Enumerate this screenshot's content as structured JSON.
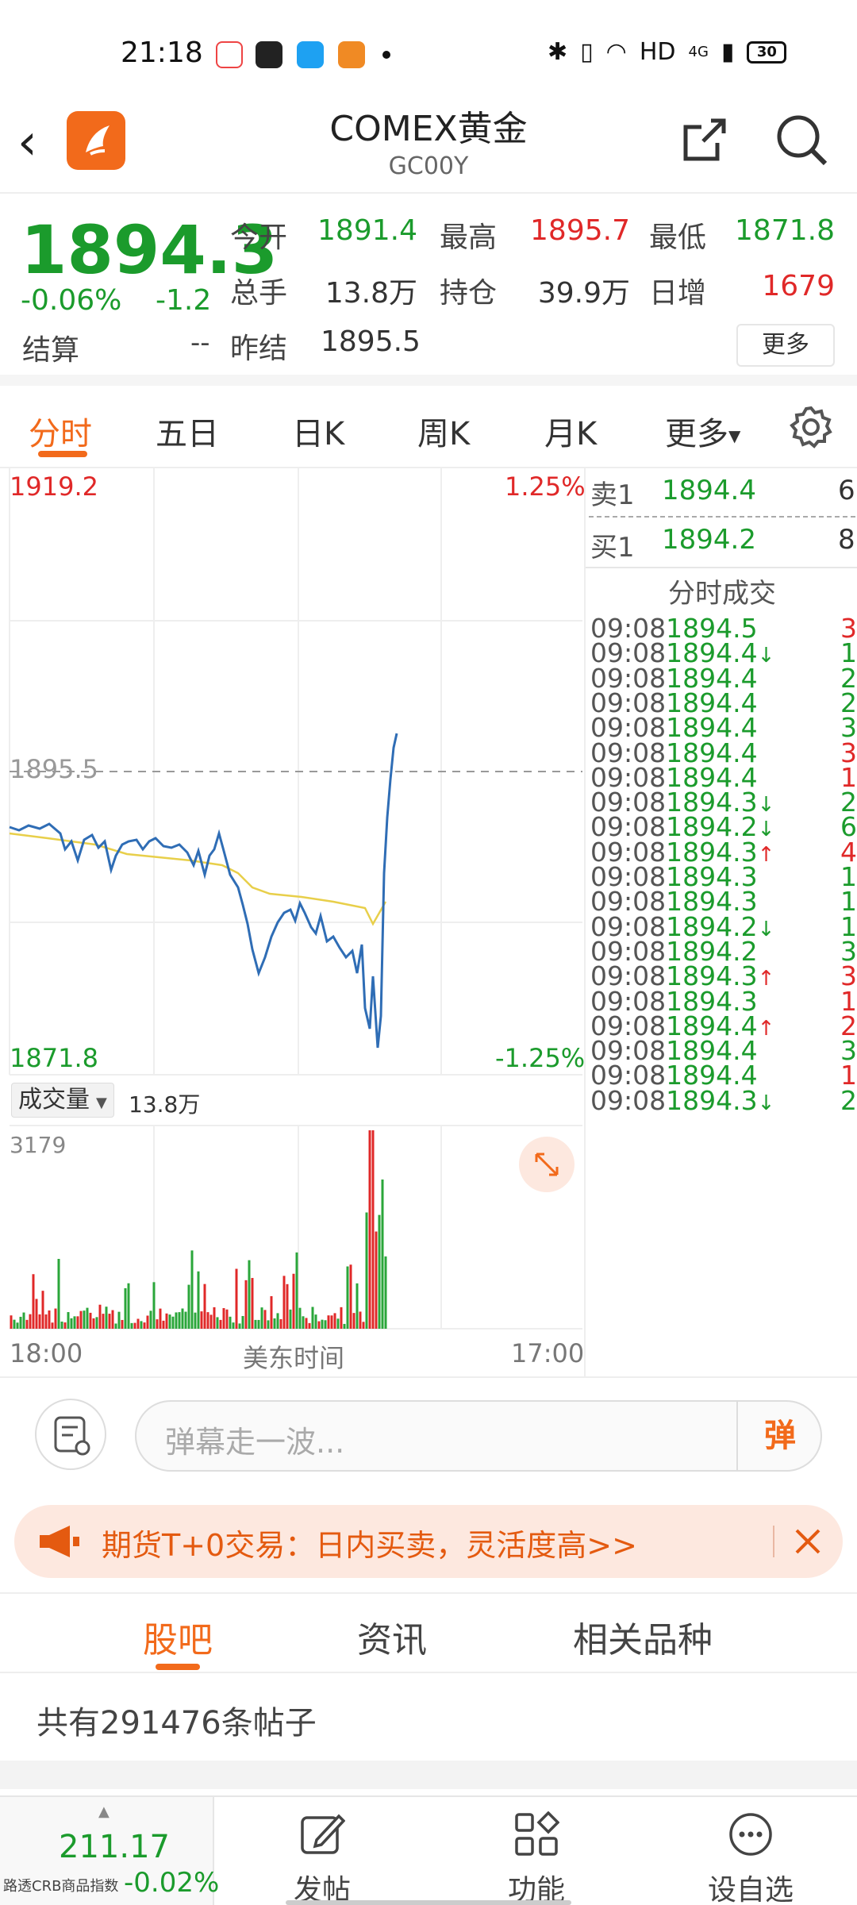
{
  "status_bar": {
    "time": "21:18",
    "network": "HD",
    "signal": "4G",
    "battery": "30"
  },
  "header": {
    "title": "COMEX黄金",
    "subtitle": "GC00Y"
  },
  "quote": {
    "price": "1894.3",
    "change_pct": "-0.06%",
    "change": "-1.2",
    "settle_label": "结算",
    "settle_value": "--",
    "stats": [
      {
        "label": "今开",
        "value": "1891.4",
        "color": "#1b9b2c"
      },
      {
        "label": "最高",
        "value": "1895.7",
        "color": "#e02828"
      },
      {
        "label": "最低",
        "value": "1871.8",
        "color": "#1b9b2c"
      },
      {
        "label": "总手",
        "value": "13.8万",
        "color": "#333333"
      },
      {
        "label": "持仓",
        "value": "39.9万",
        "color": "#333333"
      },
      {
        "label": "日增",
        "value": "1679",
        "color": "#e02828"
      },
      {
        "label": "昨结",
        "value": "1895.5",
        "color": "#333333"
      }
    ],
    "more_button": "更多"
  },
  "tabs": [
    "分时",
    "五日",
    "日K",
    "周K",
    "月K",
    "更多"
  ],
  "chart": {
    "price_high": "1919.2",
    "price_low": "1871.8",
    "pct_high": "1.25%",
    "pct_low": "-1.25%",
    "prev_settle": "1895.5",
    "volume_label": "成交量",
    "volume_total": "13.8万",
    "volume_max": "3179",
    "time_start": "18:00",
    "time_mid": "美东时间",
    "time_end": "17:00"
  },
  "order_book": {
    "sell_label": "卖1",
    "sell_price": "1894.4",
    "sell_qty": "6",
    "buy_label": "买1",
    "buy_price": "1894.2",
    "buy_qty": "8",
    "trades_title": "分时成交"
  },
  "trades": [
    {
      "time": "09:08",
      "price": "1894.5",
      "arrow": "",
      "qty": "3",
      "qty_color": "#e02828"
    },
    {
      "time": "09:08",
      "price": "1894.4",
      "arrow": "↓",
      "qty": "1",
      "qty_color": "#1b9b2c"
    },
    {
      "time": "09:08",
      "price": "1894.4",
      "arrow": "",
      "qty": "2",
      "qty_color": "#1b9b2c"
    },
    {
      "time": "09:08",
      "price": "1894.4",
      "arrow": "",
      "qty": "2",
      "qty_color": "#1b9b2c"
    },
    {
      "time": "09:08",
      "price": "1894.4",
      "arrow": "",
      "qty": "3",
      "qty_color": "#1b9b2c"
    },
    {
      "time": "09:08",
      "price": "1894.4",
      "arrow": "",
      "qty": "3",
      "qty_color": "#e02828"
    },
    {
      "time": "09:08",
      "price": "1894.4",
      "arrow": "",
      "qty": "1",
      "qty_color": "#e02828"
    },
    {
      "time": "09:08",
      "price": "1894.3",
      "arrow": "↓",
      "qty": "2",
      "qty_color": "#1b9b2c"
    },
    {
      "time": "09:08",
      "price": "1894.2",
      "arrow": "↓",
      "qty": "6",
      "qty_color": "#1b9b2c"
    },
    {
      "time": "09:08",
      "price": "1894.3",
      "arrow": "↑",
      "qty": "4",
      "qty_color": "#e02828"
    },
    {
      "time": "09:08",
      "price": "1894.3",
      "arrow": "",
      "qty": "1",
      "qty_color": "#1b9b2c"
    },
    {
      "time": "09:08",
      "price": "1894.3",
      "arrow": "",
      "qty": "1",
      "qty_color": "#1b9b2c"
    },
    {
      "time": "09:08",
      "price": "1894.2",
      "arrow": "↓",
      "qty": "1",
      "qty_color": "#1b9b2c"
    },
    {
      "time": "09:08",
      "price": "1894.2",
      "arrow": "",
      "qty": "3",
      "qty_color": "#1b9b2c"
    },
    {
      "time": "09:08",
      "price": "1894.3",
      "arrow": "↑",
      "qty": "3",
      "qty_color": "#e02828"
    },
    {
      "time": "09:08",
      "price": "1894.3",
      "arrow": "",
      "qty": "1",
      "qty_color": "#e02828"
    },
    {
      "time": "09:08",
      "price": "1894.4",
      "arrow": "↑",
      "qty": "2",
      "qty_color": "#e02828"
    },
    {
      "time": "09:08",
      "price": "1894.4",
      "arrow": "",
      "qty": "3",
      "qty_color": "#1b9b2c"
    },
    {
      "time": "09:08",
      "price": "1894.4",
      "arrow": "",
      "qty": "1",
      "qty_color": "#e02828"
    },
    {
      "time": "09:08",
      "price": "1894.3",
      "arrow": "↓",
      "qty": "2",
      "qty_color": "#1b9b2c"
    }
  ],
  "comment": {
    "placeholder": "弹幕走一波...",
    "danmu_button": "弹"
  },
  "banner": {
    "text": "期货T+0交易：日内买卖，灵活度高>>"
  },
  "sub_tabs": [
    "股吧",
    "资讯",
    "相关品种"
  ],
  "posts": {
    "text": "共有291476条帖子"
  },
  "footer": {
    "index_value": "211.17",
    "index_name": "路透CRB商品指数",
    "index_change": "-0.02%",
    "buttons": [
      "发帖",
      "功能",
      "设自选"
    ]
  },
  "colors": {
    "up": "#e02828",
    "down": "#1b9b2c",
    "accent": "#f26a1b",
    "price_line": "#2f6db5",
    "avg_line": "#e8cf4a"
  }
}
